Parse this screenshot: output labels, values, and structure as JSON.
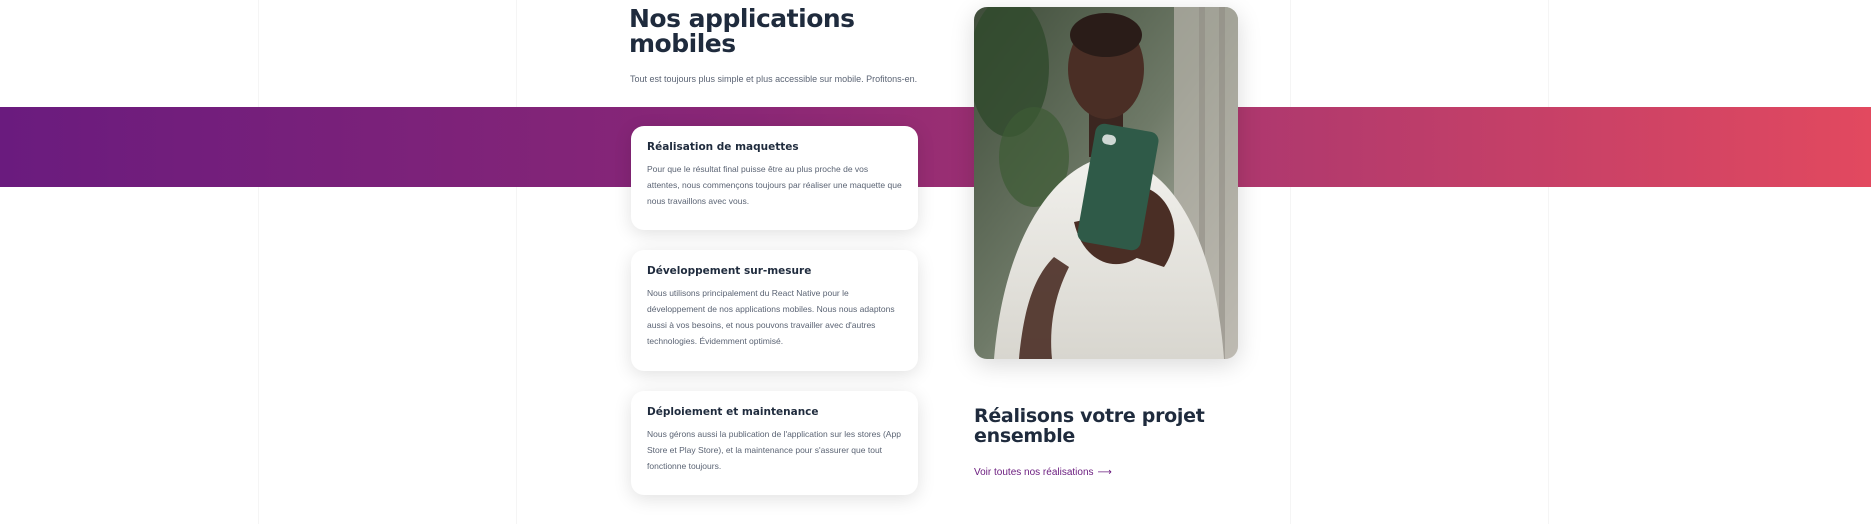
{
  "section": {
    "title": "Nos applications mobiles",
    "subtitle": "Tout est toujours plus simple et plus accessible sur mobile. Profitons-en."
  },
  "cards": [
    {
      "title": "Réalisation de maquettes",
      "text": "Pour que le résultat final puisse être au plus proche de vos attentes, nous commençons toujours par réaliser une maquette que nous travaillons avec vous."
    },
    {
      "title": "Développement sur-mesure",
      "text": "Nous utilisons principalement du React Native pour le développement de nos applications mobiles. Nous nous adaptons aussi à vos besoins, et nous pouvons travailler avec d'autres technologies. Évidemment optimisé."
    },
    {
      "title": "Déploiement et maintenance",
      "text": "Nous gérons aussi la publication de l'application sur les stores (App Store et Play Store), et la maintenance pour s'assurer que tout fonctionne toujours."
    }
  ],
  "cta": {
    "title": "Réalisons votre projet ensemble",
    "link_label": "Voir toutes nos réalisations",
    "link_arrow": "⟶"
  },
  "colors": {
    "gradient_start": "#6a1b7e",
    "gradient_end": "#e2495f",
    "heading": "#1f2b3d",
    "link": "#6a1b7e"
  },
  "icons": {
    "link_arrow": "arrow-right-icon"
  }
}
